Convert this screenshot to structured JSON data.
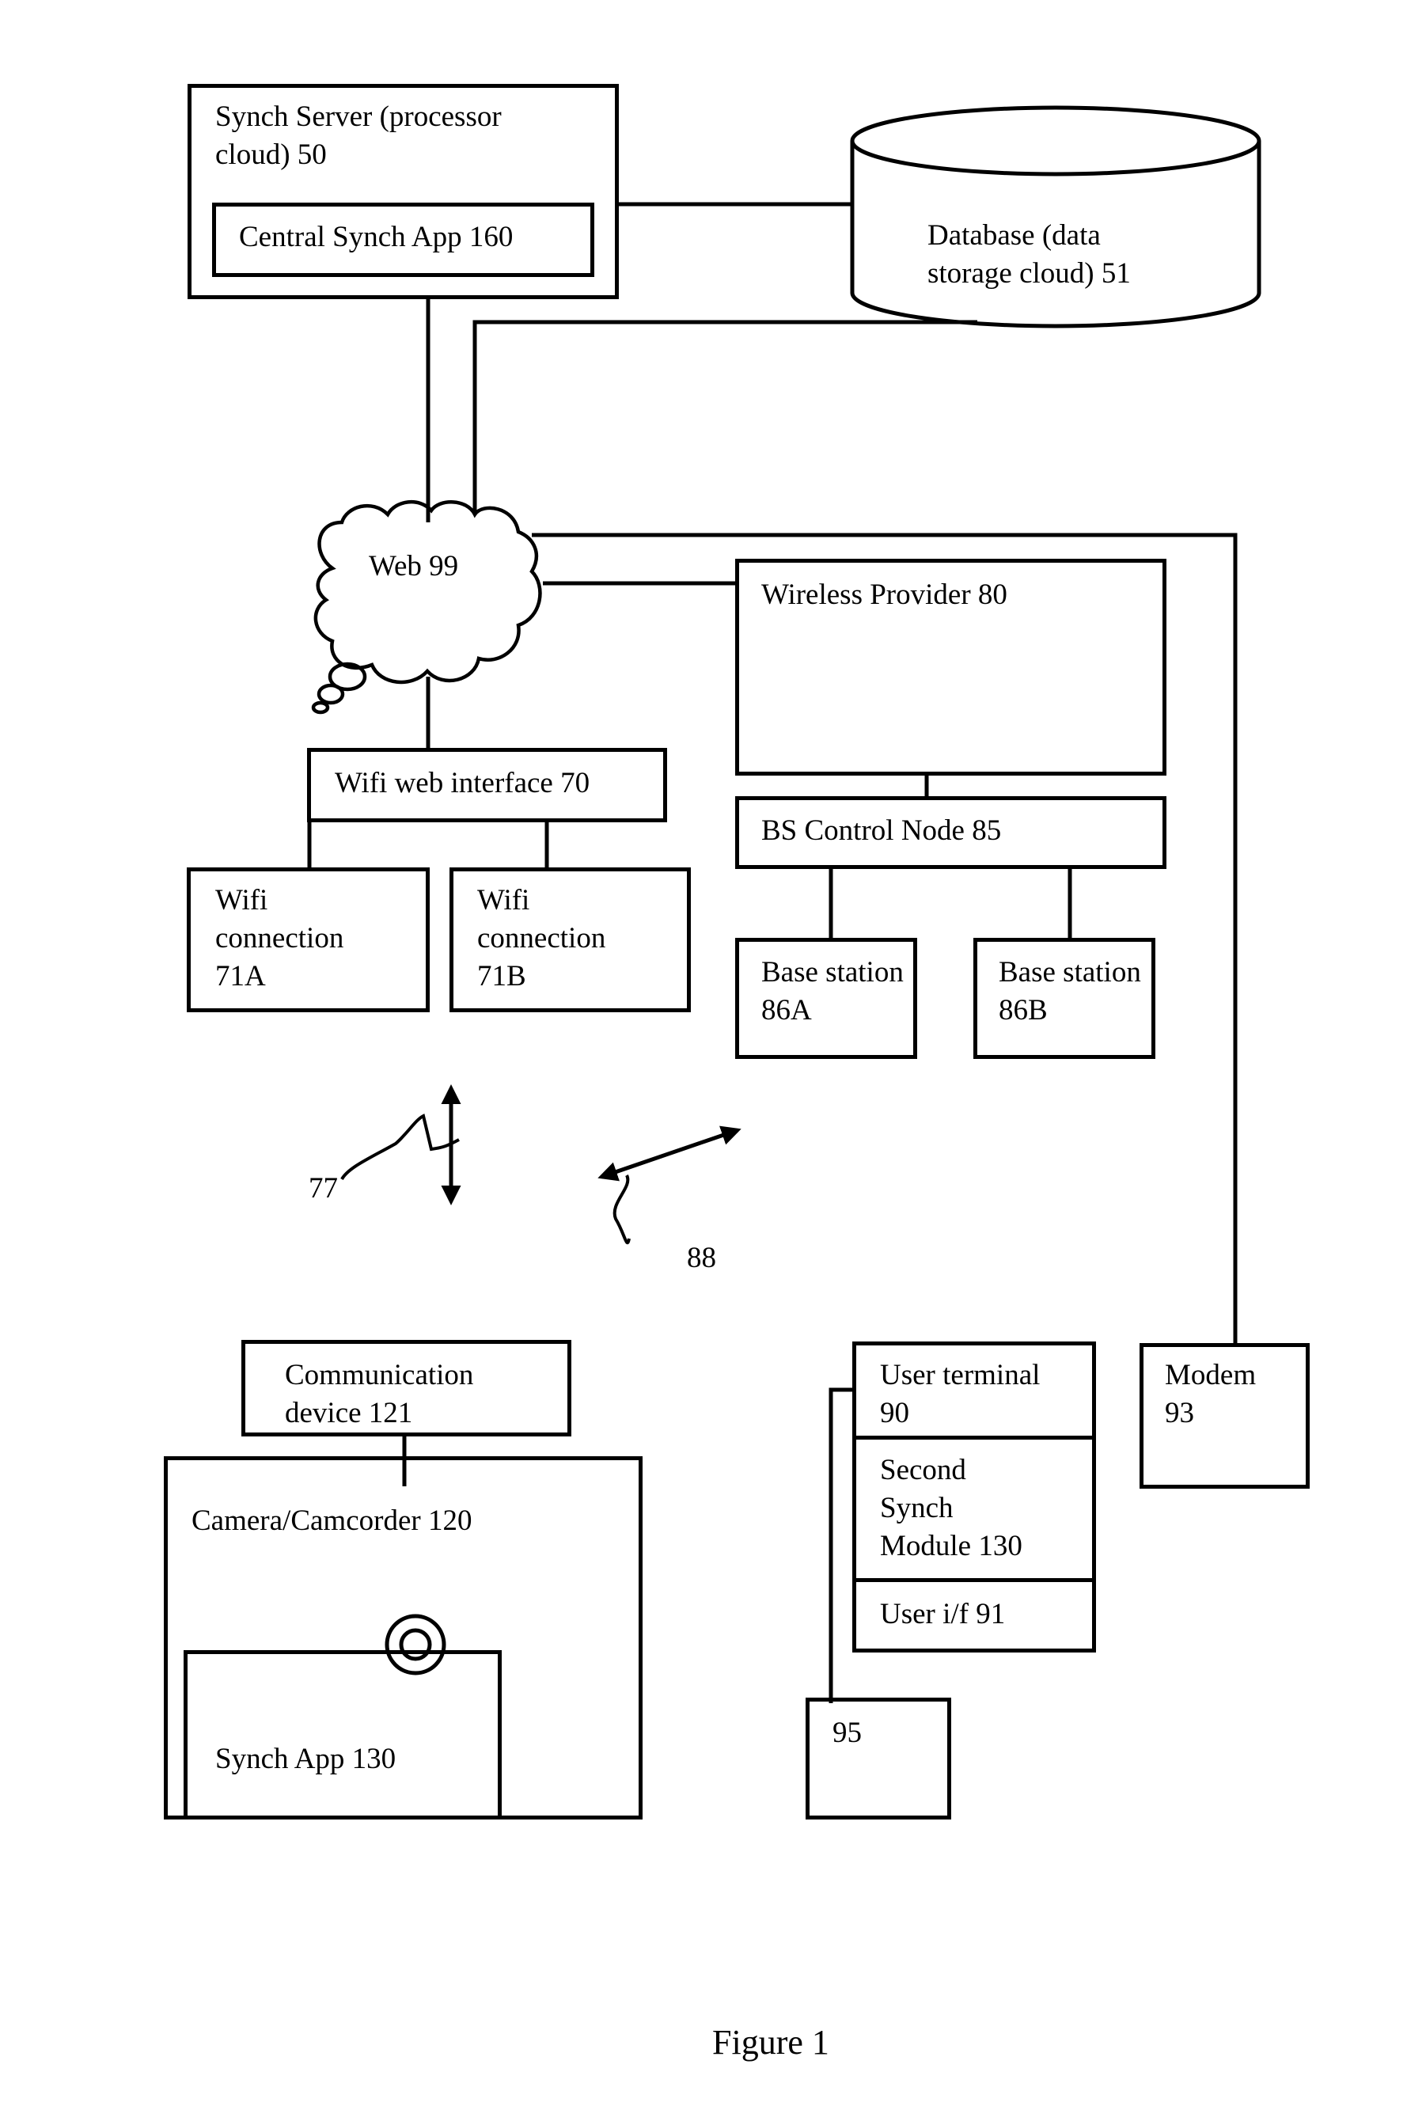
{
  "figure": {
    "caption": "Figure 1",
    "line_color": "#000000",
    "background": "#ffffff"
  },
  "nodes": {
    "synch_server": {
      "label": "Synch Server (processor\ncloud) 50"
    },
    "central_synch_app": {
      "label": "Central Synch App 160"
    },
    "database": {
      "label": "Database (data\nstorage cloud) 51"
    },
    "web": {
      "label": "Web 99"
    },
    "wireless_provider": {
      "label": "Wireless Provider 80"
    },
    "bs_control_node": {
      "label": "BS Control Node 85"
    },
    "base_station_a": {
      "label": "Base station\n86A"
    },
    "base_station_b": {
      "label": "Base station\n86B"
    },
    "wifi_web_interface": {
      "label": "Wifi web interface 70"
    },
    "wifi_connection_a": {
      "label": "Wifi\nconnection\n71A"
    },
    "wifi_connection_b": {
      "label": "Wifi\nconnection\n71B"
    },
    "communication_device": {
      "label": "Communication\ndevice 121"
    },
    "camera": {
      "label": "Camera/Camcorder 120"
    },
    "synch_app": {
      "label": "Synch App 130"
    },
    "user_terminal": {
      "label": "User terminal\n90"
    },
    "second_synch_module": {
      "label": "Second\nSynch\nModule 130"
    },
    "user_if": {
      "label": "User i/f 91"
    },
    "modem": {
      "label": "Modem\n93"
    },
    "device_95": {
      "label": "95"
    }
  },
  "annotations": {
    "link_77": "77",
    "link_88": "88"
  },
  "icons": {
    "cloud": "cloud-icon",
    "database": "cylinder-icon",
    "camera_lens": "lens-icon",
    "arrows": "double-arrow-icon"
  }
}
